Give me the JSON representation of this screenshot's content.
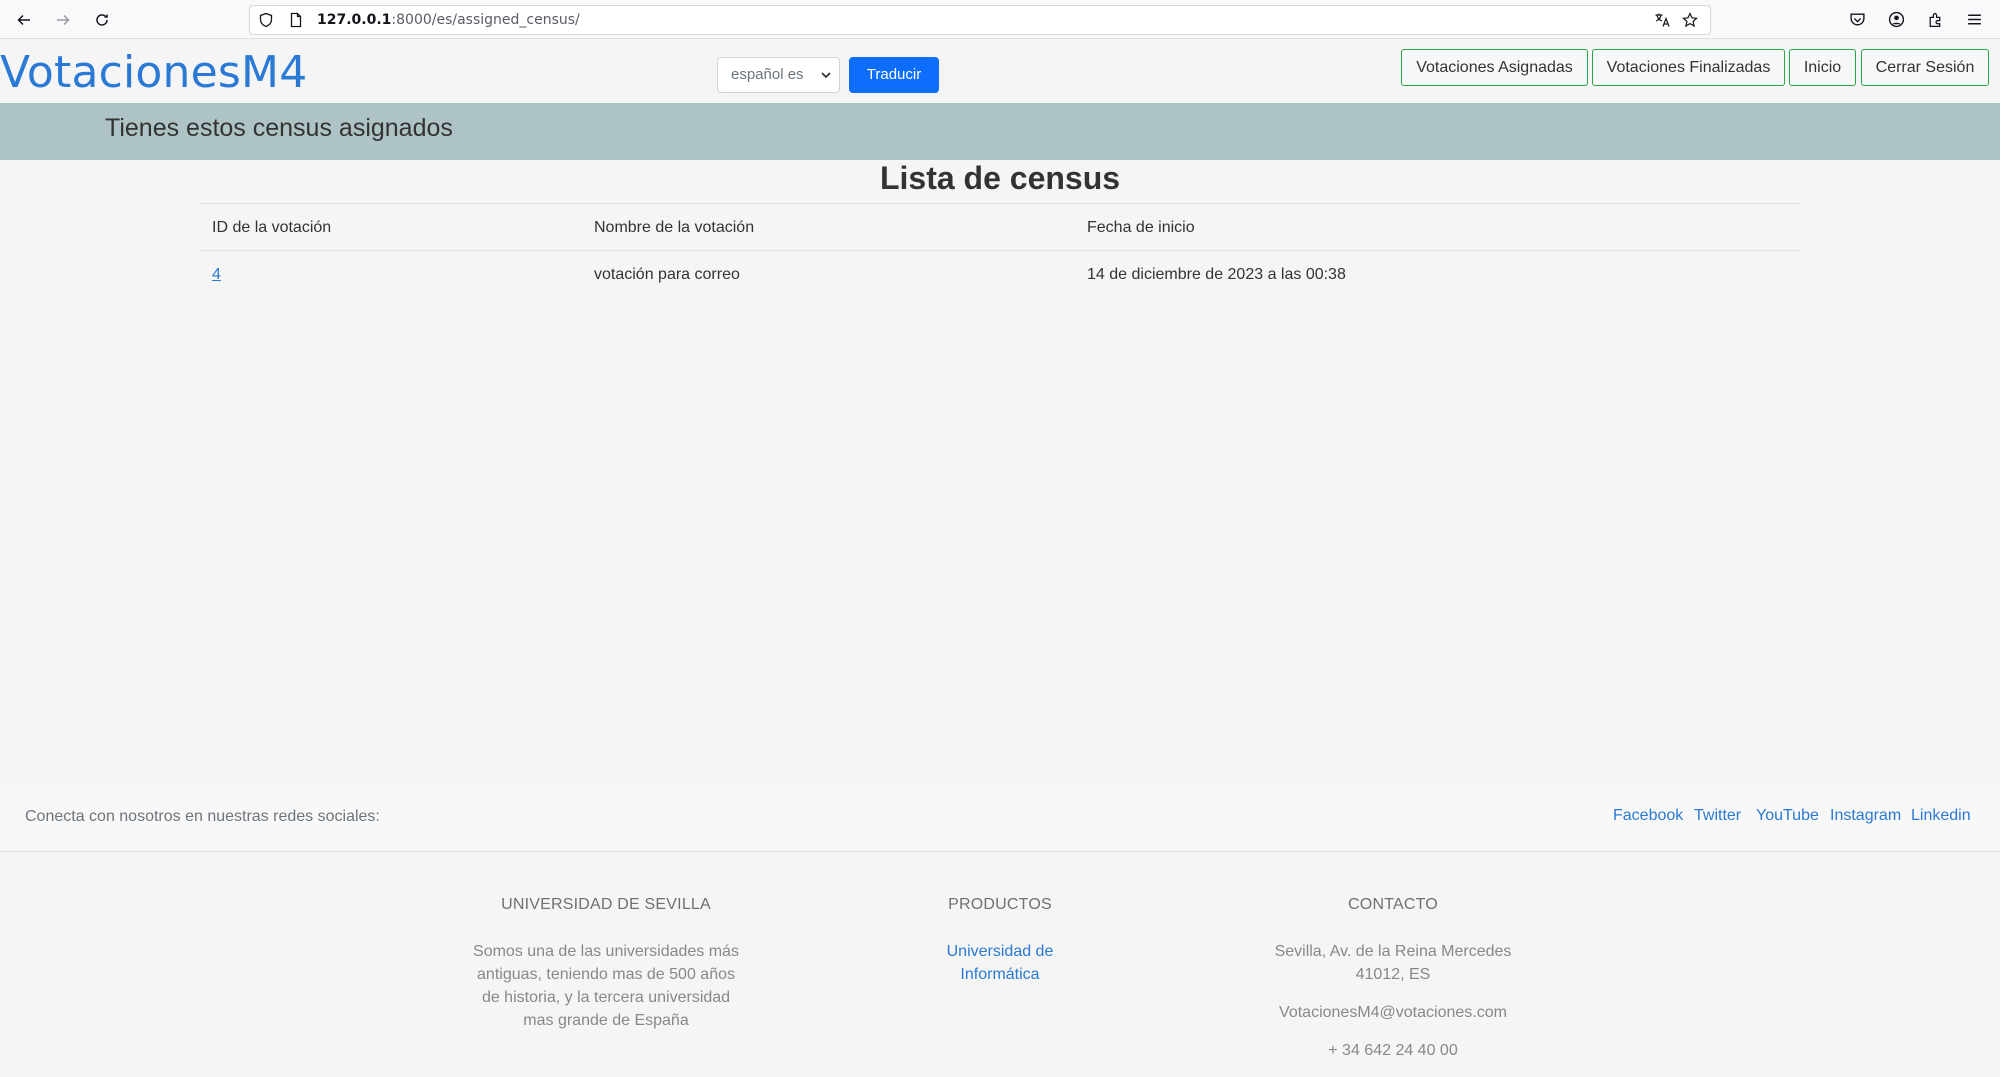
{
  "browser": {
    "url_host": "127.0.0.1",
    "url_rest": ":8000/es/assigned_census/"
  },
  "header": {
    "brand": "VotacionesM4",
    "language_select": "español es",
    "translate_button": "Traducir",
    "nav": [
      "Votaciones Asignadas",
      "Votaciones Finalizadas",
      "Inicio",
      "Cerrar Sesión"
    ]
  },
  "banner": {
    "text": "Tienes estos census asignados"
  },
  "main": {
    "title": "Lista de census",
    "columns": [
      "ID de la votación",
      "Nombre de la votación",
      "Fecha de inicio"
    ],
    "rows": [
      {
        "id": "4",
        "name": "votación para correo",
        "start": "14 de diciembre de 2023 a las 00:38"
      }
    ]
  },
  "social": {
    "text": "Conecta con nosotros en nuestras redes sociales:",
    "links": [
      "Facebook",
      "Twitter",
      "YouTube",
      "Instagram",
      "Linkedin"
    ]
  },
  "footer": {
    "university": {
      "heading": "Universidad de Sevilla",
      "lines": [
        "Somos una de las universidades más",
        "antiguas, teniendo mas de 500 años",
        "de historia, y la tercera universidad",
        "mas grande de España"
      ]
    },
    "products": {
      "heading": "Productos",
      "link_lines": [
        "Universidad de",
        "Informática"
      ]
    },
    "contact": {
      "heading": "Contacto",
      "address_lines": [
        "Sevilla, Av. de la Reina Mercedes",
        "41012, ES"
      ],
      "email": "VotacionesM4@votaciones.com",
      "phone": "+ 34 642 24 40 00"
    }
  },
  "colors": {
    "brand": "#2a7ad5",
    "banner": "#adc3c5",
    "primary_button": "#0d6efd",
    "nav_border": "#28a745"
  }
}
